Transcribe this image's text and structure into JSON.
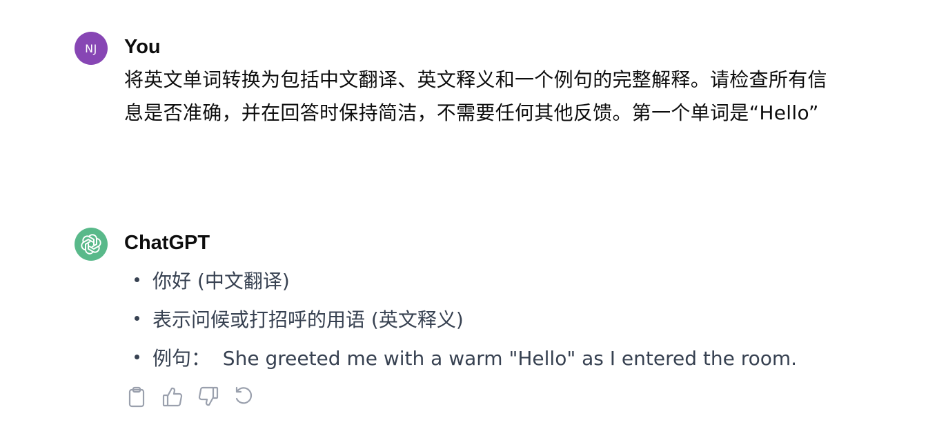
{
  "conversation": {
    "user": {
      "avatar_initials": "NJ",
      "avatar_color": "#8746b4",
      "name": "You",
      "message": "将英文单词转换为包括中文翻译、英文释义和一个例句的完整解释。请检查所有信息是否准确，并在回答时保持简洁，不需要任何其他反馈。第一个单词是“Hello”"
    },
    "assistant": {
      "name": "ChatGPT",
      "avatar_icon": "openai-logo-icon",
      "avatar_color": "#59b98a",
      "items": [
        {
          "text": "你好 (中文翻译)"
        },
        {
          "text": "表示问候或打招呼的用语 (英文释义)"
        },
        {
          "text": "例句：  She greeted me with a warm \"Hello\" as I entered the room."
        }
      ]
    },
    "actions": [
      {
        "icon": "clipboard-icon"
      },
      {
        "icon": "thumbs-up-icon"
      },
      {
        "icon": "thumbs-down-icon"
      },
      {
        "icon": "regenerate-icon"
      }
    ]
  }
}
